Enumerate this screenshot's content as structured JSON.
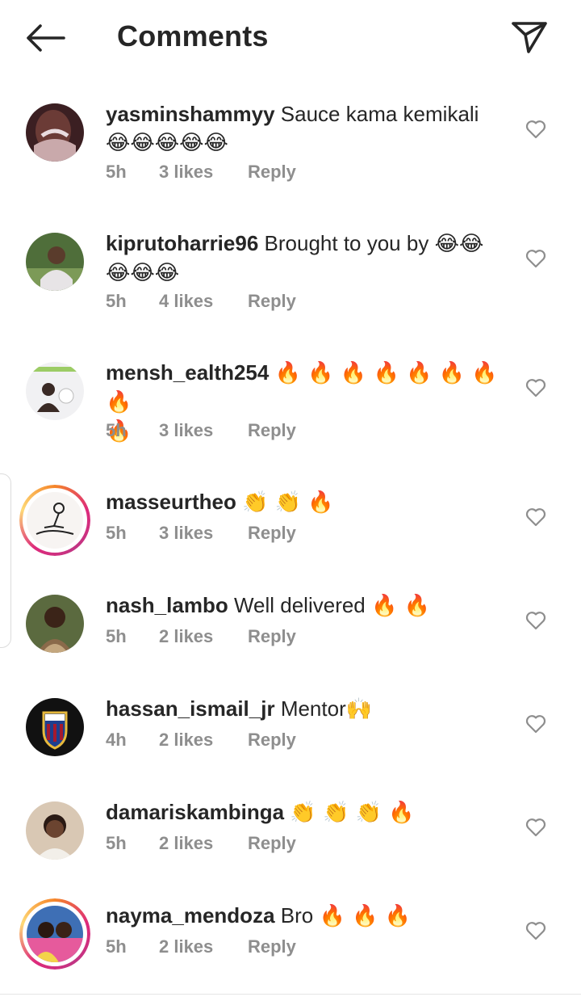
{
  "header": {
    "title": "Comments"
  },
  "comments": [
    {
      "username": "yasminshammyy",
      "text": "Sauce kama kemikali",
      "emojis": "😂😂😂😂😂",
      "time": "5h",
      "likes": "3 likes",
      "reply": "Reply"
    },
    {
      "username": "kiprutoharrie96",
      "text": "Brought to you by",
      "emojis": "😂😂",
      "emojis2": "😂😂😂",
      "time": "5h",
      "likes": "4 likes",
      "reply": "Reply"
    },
    {
      "username": "mensh_ealth254",
      "text": "",
      "emojis": "🔥 🔥 🔥 🔥 🔥 🔥 🔥 🔥",
      "emojis2": "🔥",
      "time": "5h",
      "likes": "3 likes",
      "reply": "Reply"
    },
    {
      "username": "masseurtheo",
      "text": "",
      "emojis": "👏 👏 🔥",
      "time": "5h",
      "likes": "3 likes",
      "reply": "Reply"
    },
    {
      "username": "nash_lambo",
      "text": "Well delivered",
      "emojis": "🔥 🔥",
      "time": "5h",
      "likes": "2 likes",
      "reply": "Reply"
    },
    {
      "username": "hassan_ismail_jr",
      "text": "Mentor",
      "emojis": "🙌",
      "time": "4h",
      "likes": "2 likes",
      "reply": "Reply"
    },
    {
      "username": "damariskambinga",
      "text": "",
      "emojis": "👏 👏 👏 🔥",
      "time": "5h",
      "likes": "2 likes",
      "reply": "Reply"
    },
    {
      "username": "nayma_mendoza",
      "text": "Bro",
      "emojis": "🔥 🔥 🔥",
      "time": "5h",
      "likes": "2 likes",
      "reply": "Reply"
    }
  ],
  "icons": {
    "back": "arrow-left-icon",
    "send": "paper-plane-icon",
    "like": "heart-outline-icon"
  },
  "colors": {
    "text": "#262626",
    "secondary": "#8e8e8e",
    "icon": "#262626"
  }
}
